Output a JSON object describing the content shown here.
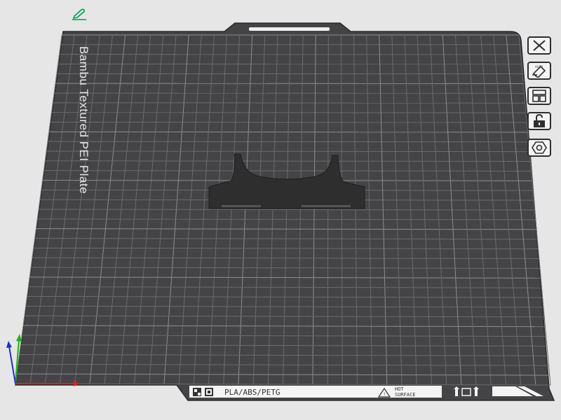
{
  "plate": {
    "name": "Bambu Textured PEI Plate",
    "filament_types": "PLA/ABS/PETG",
    "warning_line1": "HOT",
    "warning_line2": "SURFACE"
  },
  "toolbar": {
    "buttons": [
      {
        "name": "close-icon"
      },
      {
        "name": "auto-orient-icon"
      },
      {
        "name": "arrange-icon"
      },
      {
        "name": "lock-icon"
      },
      {
        "name": "plate-settings-icon"
      }
    ]
  },
  "edit_icon": {
    "name": "pencil-icon",
    "color": "#00a050"
  },
  "colors": {
    "background": "#e6e6e6",
    "plate": "#444446",
    "grid_minor": "#6b6b6d",
    "grid_major": "#8d8d8f",
    "model": "#303030",
    "axis_x": "#e02020",
    "axis_y": "#20b020",
    "axis_z": "#2030c0"
  }
}
